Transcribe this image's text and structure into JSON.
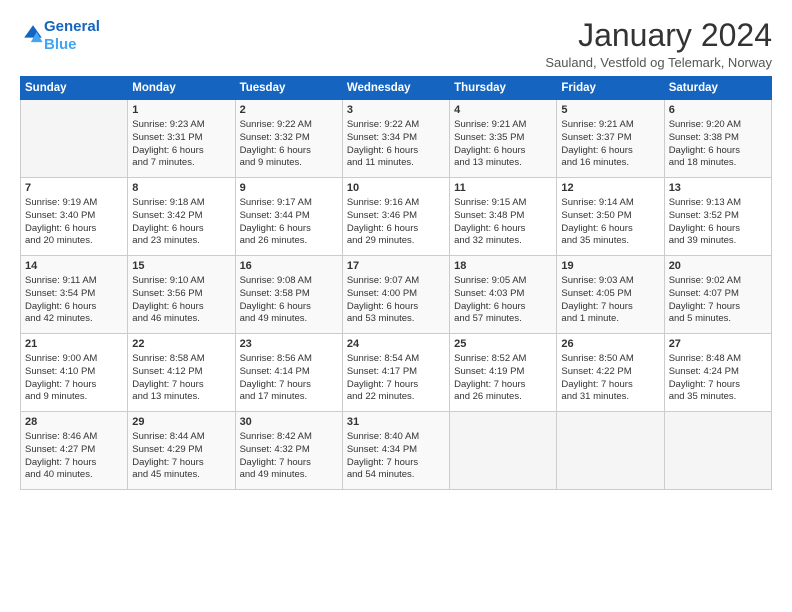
{
  "header": {
    "logo_line1": "General",
    "logo_line2": "Blue",
    "month": "January 2024",
    "location": "Sauland, Vestfold og Telemark, Norway"
  },
  "days_of_week": [
    "Sunday",
    "Monday",
    "Tuesday",
    "Wednesday",
    "Thursday",
    "Friday",
    "Saturday"
  ],
  "weeks": [
    [
      {
        "day": "",
        "content": ""
      },
      {
        "day": "1",
        "content": "Sunrise: 9:23 AM\nSunset: 3:31 PM\nDaylight: 6 hours\nand 7 minutes."
      },
      {
        "day": "2",
        "content": "Sunrise: 9:22 AM\nSunset: 3:32 PM\nDaylight: 6 hours\nand 9 minutes."
      },
      {
        "day": "3",
        "content": "Sunrise: 9:22 AM\nSunset: 3:34 PM\nDaylight: 6 hours\nand 11 minutes."
      },
      {
        "day": "4",
        "content": "Sunrise: 9:21 AM\nSunset: 3:35 PM\nDaylight: 6 hours\nand 13 minutes."
      },
      {
        "day": "5",
        "content": "Sunrise: 9:21 AM\nSunset: 3:37 PM\nDaylight: 6 hours\nand 16 minutes."
      },
      {
        "day": "6",
        "content": "Sunrise: 9:20 AM\nSunset: 3:38 PM\nDaylight: 6 hours\nand 18 minutes."
      }
    ],
    [
      {
        "day": "7",
        "content": "Sunrise: 9:19 AM\nSunset: 3:40 PM\nDaylight: 6 hours\nand 20 minutes."
      },
      {
        "day": "8",
        "content": "Sunrise: 9:18 AM\nSunset: 3:42 PM\nDaylight: 6 hours\nand 23 minutes."
      },
      {
        "day": "9",
        "content": "Sunrise: 9:17 AM\nSunset: 3:44 PM\nDaylight: 6 hours\nand 26 minutes."
      },
      {
        "day": "10",
        "content": "Sunrise: 9:16 AM\nSunset: 3:46 PM\nDaylight: 6 hours\nand 29 minutes."
      },
      {
        "day": "11",
        "content": "Sunrise: 9:15 AM\nSunset: 3:48 PM\nDaylight: 6 hours\nand 32 minutes."
      },
      {
        "day": "12",
        "content": "Sunrise: 9:14 AM\nSunset: 3:50 PM\nDaylight: 6 hours\nand 35 minutes."
      },
      {
        "day": "13",
        "content": "Sunrise: 9:13 AM\nSunset: 3:52 PM\nDaylight: 6 hours\nand 39 minutes."
      }
    ],
    [
      {
        "day": "14",
        "content": "Sunrise: 9:11 AM\nSunset: 3:54 PM\nDaylight: 6 hours\nand 42 minutes."
      },
      {
        "day": "15",
        "content": "Sunrise: 9:10 AM\nSunset: 3:56 PM\nDaylight: 6 hours\nand 46 minutes."
      },
      {
        "day": "16",
        "content": "Sunrise: 9:08 AM\nSunset: 3:58 PM\nDaylight: 6 hours\nand 49 minutes."
      },
      {
        "day": "17",
        "content": "Sunrise: 9:07 AM\nSunset: 4:00 PM\nDaylight: 6 hours\nand 53 minutes."
      },
      {
        "day": "18",
        "content": "Sunrise: 9:05 AM\nSunset: 4:03 PM\nDaylight: 6 hours\nand 57 minutes."
      },
      {
        "day": "19",
        "content": "Sunrise: 9:03 AM\nSunset: 4:05 PM\nDaylight: 7 hours\nand 1 minute."
      },
      {
        "day": "20",
        "content": "Sunrise: 9:02 AM\nSunset: 4:07 PM\nDaylight: 7 hours\nand 5 minutes."
      }
    ],
    [
      {
        "day": "21",
        "content": "Sunrise: 9:00 AM\nSunset: 4:10 PM\nDaylight: 7 hours\nand 9 minutes."
      },
      {
        "day": "22",
        "content": "Sunrise: 8:58 AM\nSunset: 4:12 PM\nDaylight: 7 hours\nand 13 minutes."
      },
      {
        "day": "23",
        "content": "Sunrise: 8:56 AM\nSunset: 4:14 PM\nDaylight: 7 hours\nand 17 minutes."
      },
      {
        "day": "24",
        "content": "Sunrise: 8:54 AM\nSunset: 4:17 PM\nDaylight: 7 hours\nand 22 minutes."
      },
      {
        "day": "25",
        "content": "Sunrise: 8:52 AM\nSunset: 4:19 PM\nDaylight: 7 hours\nand 26 minutes."
      },
      {
        "day": "26",
        "content": "Sunrise: 8:50 AM\nSunset: 4:22 PM\nDaylight: 7 hours\nand 31 minutes."
      },
      {
        "day": "27",
        "content": "Sunrise: 8:48 AM\nSunset: 4:24 PM\nDaylight: 7 hours\nand 35 minutes."
      }
    ],
    [
      {
        "day": "28",
        "content": "Sunrise: 8:46 AM\nSunset: 4:27 PM\nDaylight: 7 hours\nand 40 minutes."
      },
      {
        "day": "29",
        "content": "Sunrise: 8:44 AM\nSunset: 4:29 PM\nDaylight: 7 hours\nand 45 minutes."
      },
      {
        "day": "30",
        "content": "Sunrise: 8:42 AM\nSunset: 4:32 PM\nDaylight: 7 hours\nand 49 minutes."
      },
      {
        "day": "31",
        "content": "Sunrise: 8:40 AM\nSunset: 4:34 PM\nDaylight: 7 hours\nand 54 minutes."
      },
      {
        "day": "",
        "content": ""
      },
      {
        "day": "",
        "content": ""
      },
      {
        "day": "",
        "content": ""
      }
    ]
  ]
}
